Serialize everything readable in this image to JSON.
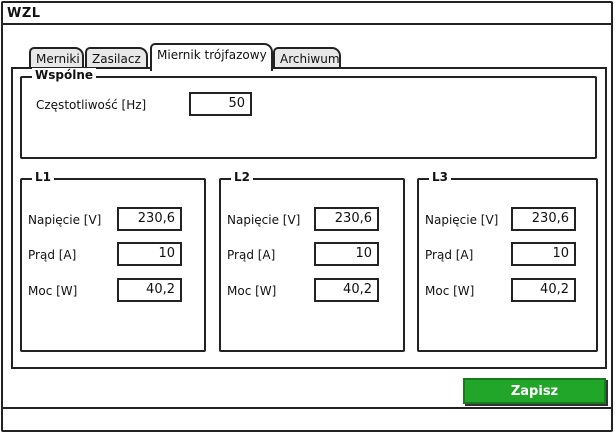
{
  "window": {
    "title": "WZL"
  },
  "tabs": [
    {
      "label": "Merniki"
    },
    {
      "label": "Zasilacz"
    },
    {
      "label": "Miernik trójfazowy"
    },
    {
      "label": "Archiwum"
    }
  ],
  "common": {
    "legend": "Wspólne",
    "frequency_label": "Częstotliwość [Hz]",
    "frequency_value": "50"
  },
  "phases": [
    {
      "legend": "L1",
      "voltage_label": "Napięcie [V]",
      "voltage_value": "230,6",
      "current_label": "Prąd [A]",
      "current_value": "10",
      "power_label": "Moc [W]",
      "power_value": "40,2"
    },
    {
      "legend": "L2",
      "voltage_label": "Napięcie [V]",
      "voltage_value": "230,6",
      "current_label": "Prąd [A]",
      "current_value": "10",
      "power_label": "Moc [W]",
      "power_value": "40,2"
    },
    {
      "legend": "L3",
      "voltage_label": "Napięcie [V]",
      "voltage_value": "230,6",
      "current_label": "Prąd [A]",
      "current_value": "10",
      "power_label": "Moc [W]",
      "power_value": "40,2"
    }
  ],
  "actions": {
    "save_label": "Zapisz"
  },
  "colors": {
    "save_button": "#22a62a"
  }
}
